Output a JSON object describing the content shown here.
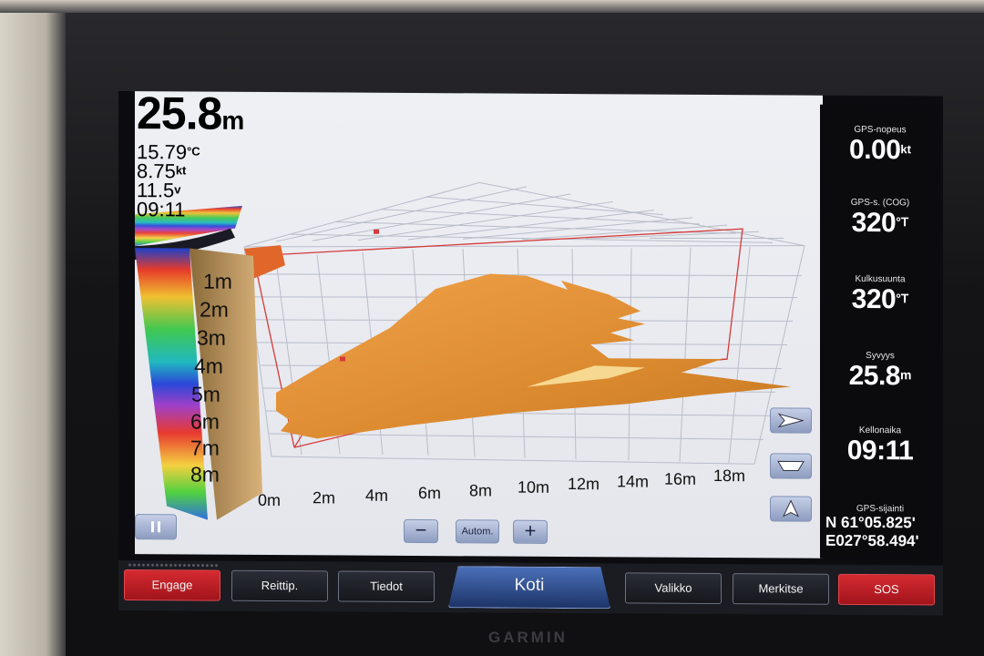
{
  "readout": {
    "depth_value": "25.8",
    "depth_unit": "m",
    "water_temp": "15.79",
    "water_temp_unit": "°C",
    "speed": "8.75",
    "speed_unit": "kt",
    "voltage": "11.5",
    "voltage_unit": "v",
    "time": "09:11"
  },
  "depth_scale": [
    "1m",
    "2m",
    "3m",
    "4m",
    "5m",
    "6m",
    "7m",
    "8m"
  ],
  "distance_scale": [
    "0m",
    "2m",
    "4m",
    "6m",
    "8m",
    "10m",
    "12m",
    "14m",
    "16m",
    "18m"
  ],
  "zoom": {
    "minus": "−",
    "auto": "Autom.",
    "plus": "+"
  },
  "pause_icon": "pause-icon",
  "view_icons": [
    "flat-view-icon",
    "perspective-view-icon",
    "north-up-icon"
  ],
  "data_panel": {
    "gps_speed": {
      "label": "GPS-nopeus",
      "value": "0.00",
      "unit": "kt"
    },
    "cog": {
      "label": "GPS-s. (COG)",
      "value": "320",
      "unit": "°T"
    },
    "heading": {
      "label": "Kulkusuunta",
      "value": "320",
      "unit": "°T"
    },
    "depth": {
      "label": "Syvyys",
      "value": "25.8",
      "unit": "m"
    },
    "clock": {
      "label": "Kellonaika",
      "value": "09:11"
    },
    "position": {
      "label": "GPS-sijainti",
      "lat": "N  61°05.825'",
      "lon": "E027°58.494'"
    }
  },
  "softkeys": {
    "engage": "Engage",
    "route": "Reittip.",
    "info": "Tiedot",
    "home": "Koti",
    "menu": "Valikko",
    "mark": "Merkitse",
    "sos": "SOS"
  },
  "brand": "GARMIN",
  "colors": {
    "sonar_bottom": "#e8932e",
    "grid": "#b8bcc8",
    "alert_red": "#d52a31",
    "home_blue": "#2b4a8e"
  }
}
